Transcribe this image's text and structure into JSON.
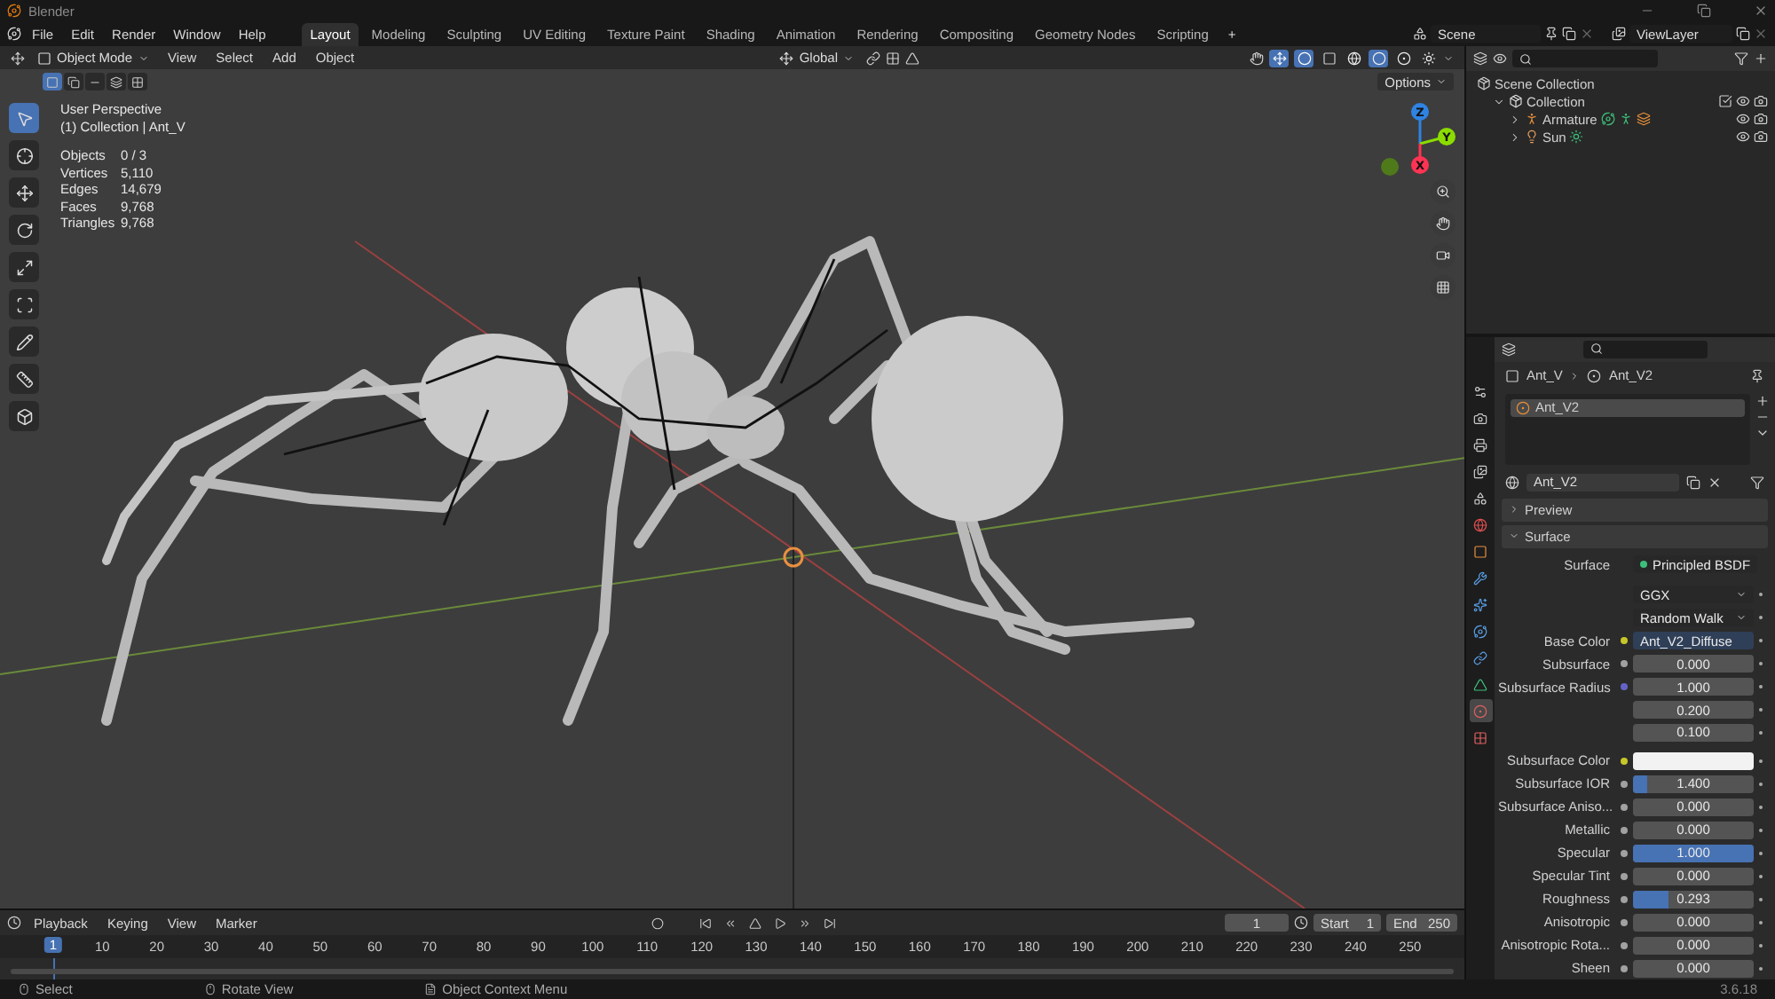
{
  "title_bar": {
    "title": "Blender"
  },
  "menu_bar": {
    "menus": [
      "File",
      "Edit",
      "Render",
      "Window",
      "Help"
    ],
    "workspaces": [
      {
        "label": "Layout",
        "selected": true
      },
      {
        "label": "Modeling",
        "selected": false
      },
      {
        "label": "Sculpting",
        "selected": false
      },
      {
        "label": "UV Editing",
        "selected": false
      },
      {
        "label": "Texture Paint",
        "selected": false
      },
      {
        "label": "Shading",
        "selected": false
      },
      {
        "label": "Animation",
        "selected": false
      },
      {
        "label": "Rendering",
        "selected": false
      },
      {
        "label": "Compositing",
        "selected": false
      },
      {
        "label": "Geometry Nodes",
        "selected": false
      },
      {
        "label": "Scripting",
        "selected": false
      }
    ],
    "add_workspace": "+",
    "scene": "Scene",
    "view_layer": "ViewLayer"
  },
  "viewport": {
    "mode": "Object Mode",
    "menus": [
      "View",
      "Select",
      "Add",
      "Object"
    ],
    "orientation": "Global",
    "options": "Options",
    "select_modes": [
      {
        "kind": "new",
        "selected": true
      },
      {
        "kind": "extend",
        "selected": false
      },
      {
        "kind": "subtract",
        "selected": false
      },
      {
        "kind": "invert",
        "selected": false
      },
      {
        "kind": "intersect",
        "selected": false
      }
    ],
    "shading": [
      {
        "kind": "wireframe",
        "selected": false
      },
      {
        "kind": "solid",
        "selected": true
      },
      {
        "kind": "material",
        "selected": false
      },
      {
        "kind": "rendered",
        "selected": false
      }
    ],
    "view_name": "User Perspective",
    "context": "(1) Collection | Ant_V",
    "stats": [
      {
        "label": "Objects",
        "value": "0 / 3"
      },
      {
        "label": "Vertices",
        "value": "5,110"
      },
      {
        "label": "Edges",
        "value": "14,679"
      },
      {
        "label": "Faces",
        "value": "9,768"
      },
      {
        "label": "Triangles",
        "value": "9,768"
      }
    ],
    "tools": [
      {
        "kind": "select",
        "selected": true
      },
      {
        "kind": "cursor",
        "selected": false
      },
      {
        "kind": "move",
        "selected": false
      },
      {
        "kind": "rotate",
        "selected": false
      },
      {
        "kind": "scale",
        "selected": false
      },
      {
        "kind": "transform",
        "selected": false
      },
      {
        "kind": "annotate",
        "selected": false
      },
      {
        "kind": "measure",
        "selected": false
      },
      {
        "kind": "add_cube",
        "selected": false
      }
    ],
    "gizmo": [
      {
        "axis": "Z",
        "color": "#2f83e3"
      },
      {
        "axis": "Y",
        "color": "#8bdc00"
      },
      {
        "axis": "X",
        "color": "#ff3352"
      }
    ]
  },
  "outliner": {
    "root": "Scene Collection",
    "items": [
      {
        "label": "Collection",
        "kind": "collection",
        "expanded": true,
        "children": [
          {
            "label": "Armature",
            "kind": "armature",
            "expanded": false
          },
          {
            "label": "Sun",
            "kind": "light",
            "expanded": false
          }
        ]
      }
    ]
  },
  "properties": {
    "tabs": [
      {
        "kind": "tool",
        "selected": false
      },
      {
        "kind": "render",
        "selected": false
      },
      {
        "kind": "output",
        "selected": false
      },
      {
        "kind": "view_layer",
        "selected": false
      },
      {
        "kind": "scene",
        "selected": false
      },
      {
        "kind": "world",
        "selected": false
      },
      {
        "kind": "object",
        "selected": false
      },
      {
        "kind": "modifiers",
        "selected": false
      },
      {
        "kind": "particles",
        "selected": false
      },
      {
        "kind": "physics",
        "selected": false
      },
      {
        "kind": "constraints",
        "selected": false
      },
      {
        "kind": "data",
        "selected": false
      },
      {
        "kind": "material",
        "selected": true
      },
      {
        "kind": "texture",
        "selected": false
      }
    ],
    "breadcrumb": [
      "Ant_V",
      "Ant_V2"
    ],
    "slots": [
      {
        "label": "Ant_V2",
        "selected": true
      }
    ],
    "material": "Ant_V2",
    "panels": [
      {
        "label": "Preview",
        "expanded": false
      },
      {
        "label": "Surface",
        "expanded": true
      }
    ],
    "surface_label": "Surface",
    "shader": "Principled BSDF",
    "dropdowns": [
      "GGX",
      "Random Walk"
    ],
    "inputs": [
      {
        "kind": "link",
        "label": "Base Color",
        "value": "Ant_V2_Diffuse",
        "color": "#c7c729"
      },
      {
        "kind": "slider",
        "label": "Subsurface",
        "value": "0.000",
        "level": 0,
        "color": "#a1a1a1"
      },
      {
        "kind": "vector",
        "label": "Subsurface Radius",
        "values": [
          "1.000",
          "0.200",
          "0.100"
        ],
        "color": "#6363c7"
      },
      {
        "kind": "swatch",
        "label": "Subsurface Color",
        "color": "#c7c729"
      },
      {
        "kind": "slider",
        "label": "Subsurface IOR",
        "value": "1.400",
        "level": 0.12,
        "color": "#a1a1a1"
      },
      {
        "kind": "slider",
        "label": "Subsurface Aniso...",
        "value": "0.000",
        "level": 0,
        "color": "#a1a1a1"
      },
      {
        "kind": "slider",
        "label": "Metallic",
        "value": "0.000",
        "level": 0,
        "color": "#a1a1a1"
      },
      {
        "kind": "slider",
        "label": "Specular",
        "value": "1.000",
        "level": 1,
        "color": "#a1a1a1"
      },
      {
        "kind": "slider",
        "label": "Specular Tint",
        "value": "0.000",
        "level": 0,
        "color": "#a1a1a1"
      },
      {
        "kind": "slider",
        "label": "Roughness",
        "value": "0.293",
        "level": 0.293,
        "color": "#a1a1a1"
      },
      {
        "kind": "slider",
        "label": "Anisotropic",
        "value": "0.000",
        "level": 0,
        "color": "#a1a1a1"
      },
      {
        "kind": "slider",
        "label": "Anisotropic Rota...",
        "value": "0.000",
        "level": 0,
        "color": "#a1a1a1"
      },
      {
        "kind": "slider",
        "label": "Sheen",
        "value": "0.000",
        "level": 0,
        "color": "#a1a1a1"
      }
    ]
  },
  "timeline": {
    "menus": [
      "Playback",
      "Keying",
      "View",
      "Marker"
    ],
    "current_frame": "1",
    "start_label": "Start",
    "start": "1",
    "end_label": "End",
    "end": "250",
    "ticks": [
      "1",
      "10",
      "20",
      "30",
      "40",
      "50",
      "60",
      "70",
      "80",
      "90",
      "100",
      "110",
      "120",
      "130",
      "140",
      "150",
      "160",
      "170",
      "180",
      "190",
      "200",
      "210",
      "220",
      "230",
      "240",
      "250"
    ]
  },
  "status_bar": {
    "hints": [
      "Select",
      "Rotate View",
      "Object Context Menu"
    ],
    "version": "3.6.18"
  }
}
